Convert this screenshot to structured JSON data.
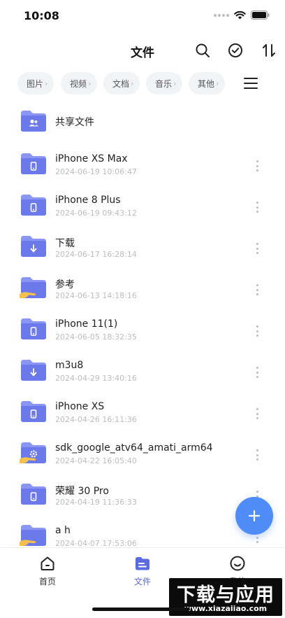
{
  "status_bar": {
    "time": "10:08"
  },
  "header": {
    "title": "文件",
    "icons": [
      "search-icon",
      "select-check-icon",
      "sort-icon"
    ]
  },
  "filters": {
    "chips": [
      {
        "label": "图片"
      },
      {
        "label": "视频"
      },
      {
        "label": "文档"
      },
      {
        "label": "音乐"
      },
      {
        "label": "其他"
      }
    ]
  },
  "shared": {
    "label": "共享文件"
  },
  "files": [
    {
      "name": "iPhone XS Max",
      "date": "2024-06-19 10:06:47",
      "icon": "phone"
    },
    {
      "name": "iPhone 8 Plus",
      "date": "2024-06-19 09:43:12",
      "icon": "phone"
    },
    {
      "name": "下载",
      "date": "2024-06-17 16:28:14",
      "icon": "download"
    },
    {
      "name": "参考",
      "date": "2024-06-13 14:18:16",
      "icon": "hand"
    },
    {
      "name": "iPhone 11(1)",
      "date": "2024-06-05 18:32:35",
      "icon": "phone"
    },
    {
      "name": "m3u8",
      "date": "2024-04-29 13:40:16",
      "icon": "download"
    },
    {
      "name": "iPhone XS",
      "date": "2024-04-26 16:11:36",
      "icon": "phone"
    },
    {
      "name": "sdk_google_atv64_amati_arm64",
      "date": "2024-04-22 16:05:40",
      "icon": "gear-hand"
    },
    {
      "name": "荣耀 30 Pro",
      "date": "2024-04-19 11:36:33",
      "icon": "phone"
    },
    {
      "name": "a h",
      "date": "2024-04-07 17:53:06",
      "icon": "hand"
    }
  ],
  "tab_bar": {
    "tabs": [
      {
        "label": "首页",
        "icon": "home-icon"
      },
      {
        "label": "文件",
        "icon": "files-icon",
        "active": true
      },
      {
        "label": "我的",
        "icon": "profile-icon"
      }
    ]
  },
  "watermark": {
    "main": "下载与应用",
    "sub": "www.xiazaiiao.com"
  },
  "colors": {
    "accent": "#5b6bdf",
    "folder_back": "#8a96f2",
    "folder_front": "#6b79ea",
    "fab": "#4f8cf7",
    "hand": "#f5c14e"
  }
}
